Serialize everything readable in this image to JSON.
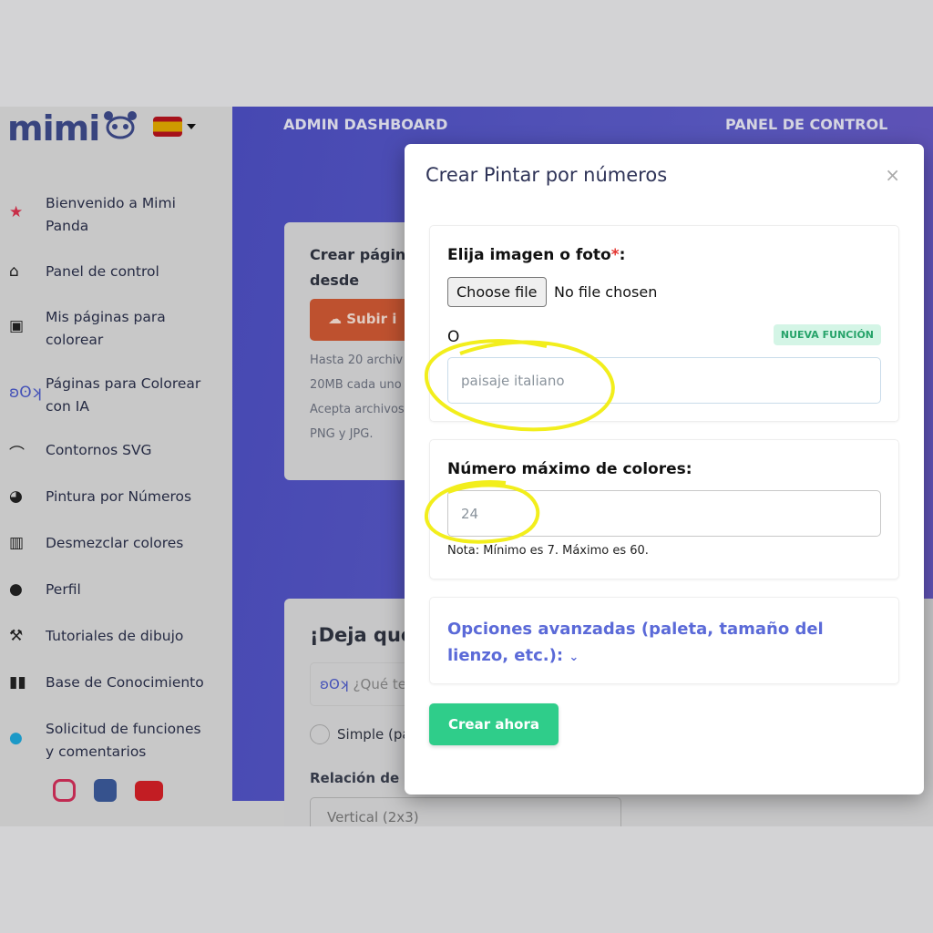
{
  "brand": {
    "logo": "mimi",
    "language": "Español"
  },
  "sidebar": {
    "items": [
      {
        "label": "Bienvenido a Mimi Panda",
        "icon": "star-icon"
      },
      {
        "label": "Panel de control",
        "icon": "home-icon"
      },
      {
        "label": "Mis páginas para colorear",
        "icon": "image-icon"
      },
      {
        "label": "Páginas para Colorear con IA",
        "icon": "panda-icon"
      },
      {
        "label": "Contornos SVG",
        "icon": "bezier-icon"
      },
      {
        "label": "Pintura por Números",
        "icon": "palette-icon"
      },
      {
        "label": "Desmezclar colores",
        "icon": "swatches-icon"
      },
      {
        "label": "Perfil",
        "icon": "user-icon"
      },
      {
        "label": "Tutoriales de dibujo",
        "icon": "compass-icon"
      },
      {
        "label": "Base de Conocimiento",
        "icon": "books-icon"
      },
      {
        "label": "Solicitud de funciones y comentarios",
        "icon": "lightbulb-icon"
      }
    ],
    "social": [
      "instagram",
      "facebook",
      "youtube"
    ]
  },
  "header": {
    "left": "ADMIN DASHBOARD",
    "right": "PANEL DE CONTROL"
  },
  "background": {
    "card1_title": "Crear página colorear desde",
    "upload_label": "Subir i",
    "card1_text": [
      "Hasta 20 archiv",
      "20MB cada uno",
      "Acepta archivos",
      "PNG y JPG."
    ],
    "card2_title": "¡Deja que",
    "prompt_placeholder": "¿Qué te",
    "radio_label": "Simple (pa",
    "ratio_label": "Relación de as",
    "ratio_value": "Vertical (2x3)"
  },
  "modal": {
    "title": "Crear Pintar por números",
    "close": "×",
    "image_label": "Elija imagen o foto",
    "required": "*",
    "colon": ":",
    "file_button": "Choose file",
    "file_status": "No file chosen",
    "or": "O",
    "badge": "NUEVA FUNCIÓN",
    "prompt_placeholder": "paisaje italiano",
    "colors_label": "Número máximo de colores:",
    "colors_placeholder": "24",
    "colors_note": "Nota: Mínimo es 7. Máximo es 60.",
    "advanced": "Opciones avanzadas (paleta, tamaño del lienzo, etc.):",
    "submit": "Crear ahora"
  },
  "colors": {
    "accent": "#5b6ad8",
    "submit": "#2fcd8a",
    "badge_text": "#27a36a",
    "highlight": "#f2ee1c",
    "upload": "#cf5834"
  }
}
